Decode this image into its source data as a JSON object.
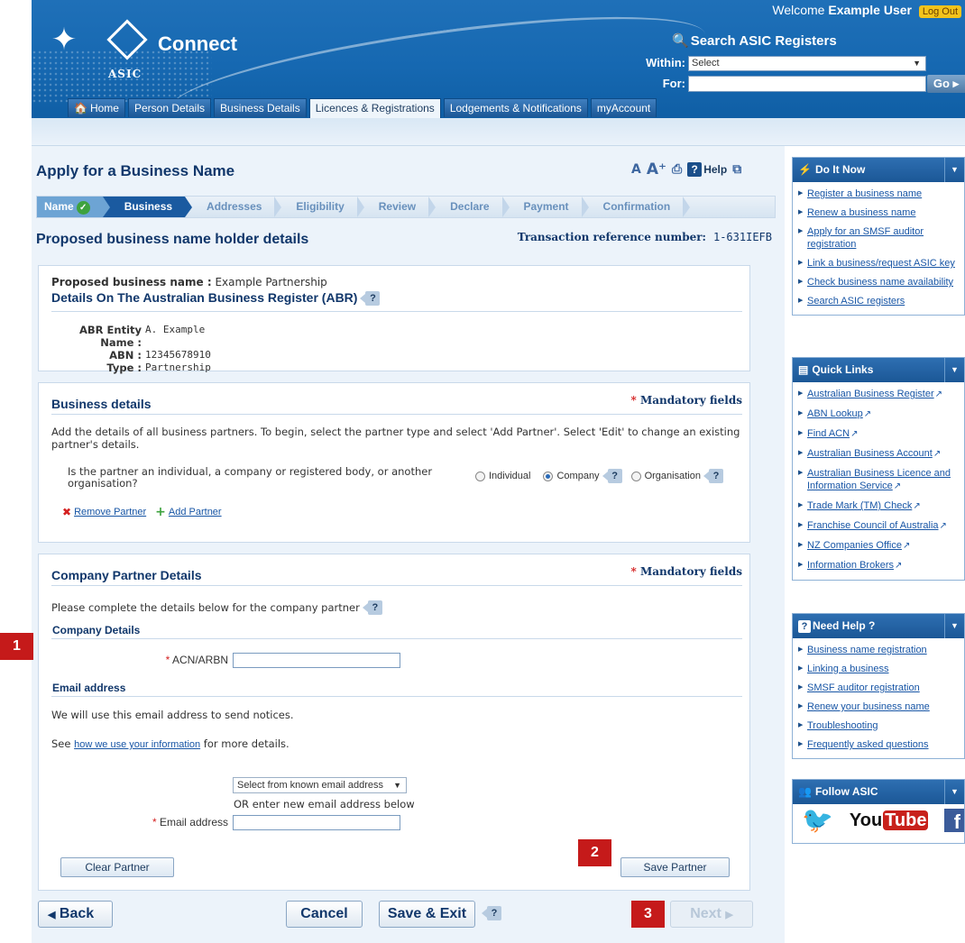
{
  "header": {
    "welcome_prefix": "Welcome",
    "user_name": "Example User",
    "logout_label": "Log Out",
    "brand_name": "Connect",
    "org_name": "ASIC",
    "search_title": "Search ASIC Registers",
    "within_label": "Within:",
    "within_value": "Select",
    "for_label": "For:",
    "for_value": "",
    "go_label": "Go",
    "tabs": [
      {
        "label": "Home"
      },
      {
        "label": "Person Details"
      },
      {
        "label": "Business Details"
      },
      {
        "label": "Licences & Registrations"
      },
      {
        "label": "Lodgements & Notifications"
      },
      {
        "label": "myAccount"
      }
    ],
    "active_tab": "Licences & Registrations"
  },
  "page": {
    "title": "Apply for a Business Name",
    "help_label": "Help",
    "steps": [
      {
        "label": "Name",
        "state": "done"
      },
      {
        "label": "Business",
        "state": "current"
      },
      {
        "label": "Addresses",
        "state": "todo"
      },
      {
        "label": "Eligibility",
        "state": "todo"
      },
      {
        "label": "Review",
        "state": "todo"
      },
      {
        "label": "Declare",
        "state": "todo"
      },
      {
        "label": "Payment",
        "state": "todo"
      },
      {
        "label": "Confirmation",
        "state": "todo"
      }
    ],
    "section_title": "Proposed business name holder details",
    "txref_label": "Transaction reference number:",
    "txref_value": "1-631IEFB"
  },
  "abr_panel": {
    "proposed_label": "Proposed business name :",
    "proposed_value": "Example Partnership",
    "heading": "Details On The Australian Business Register (ABR)",
    "entity_label": "ABR Entity Name :",
    "entity_value": "A. Example",
    "abn_label": "ABN :",
    "abn_value": "12345678910",
    "type_label": "Type :",
    "type_value": "Partnership"
  },
  "business_panel": {
    "heading": "Business details",
    "mandatory": "Mandatory fields",
    "intro": "Add the details of all business partners. To begin, select the partner type and select 'Add Partner'. Select 'Edit' to change an existing partner's details.",
    "question": "Is the partner an individual, a company or registered body, or another organisation?",
    "options": [
      "Individual",
      "Company",
      "Organisation"
    ],
    "selected": "Company",
    "remove_label": "Remove Partner",
    "add_label": "Add Partner"
  },
  "company_panel": {
    "heading": "Company Partner Details",
    "mandatory": "Mandatory fields",
    "intro": "Please complete the details below for the company partner",
    "company_details_heading": "Company Details",
    "acn_label": "ACN/ARBN",
    "acn_value": "",
    "email_heading": "Email address",
    "email_notice": "We will use this email address to send notices.",
    "see_prefix": "See",
    "see_link": "how we use your information",
    "see_suffix": "for more details.",
    "email_select_value": "Select from known email address",
    "or_text": "OR enter new email address below",
    "email_label": "Email address",
    "email_value": "",
    "clear_label": "Clear Partner",
    "save_label": "Save Partner"
  },
  "footer_buttons": {
    "back_label": "Back",
    "cancel_label": "Cancel",
    "save_exit_label": "Save & Exit",
    "next_label": "Next"
  },
  "badges": [
    "1",
    "2",
    "3"
  ],
  "sidebar": {
    "do_it_now": {
      "title": "Do It Now",
      "items": [
        "Register a business name",
        "Renew a business name",
        "Apply for an SMSF auditor registration",
        "Link a business/request ASIC key",
        "Check business name availability",
        "Search ASIC registers"
      ]
    },
    "quick_links": {
      "title": "Quick Links",
      "items": [
        "Australian Business Register",
        "ABN Lookup",
        "Find ACN",
        "Australian Business Account",
        "Australian Business Licence and Information Service",
        "Trade Mark (TM) Check",
        "Franchise Council of Australia",
        "NZ Companies Office",
        "Information Brokers"
      ]
    },
    "need_help": {
      "title": "Need Help ?",
      "items": [
        "Business name registration",
        "Linking a business",
        "SMSF auditor registration",
        "Renew your business name",
        "Troubleshooting",
        "Frequently asked questions"
      ]
    },
    "follow": {
      "title": "Follow ASIC",
      "youtube_you": "You",
      "youtube_tube": "Tube",
      "facebook": "f"
    }
  },
  "colors": {
    "brand_blue": "#1668b1",
    "title_navy": "#11376b",
    "panel_bg": "#ecf3fa",
    "badge_red": "#c51a1a",
    "mandatory_red": "#d42020",
    "step_current": "#1a5aa0"
  }
}
